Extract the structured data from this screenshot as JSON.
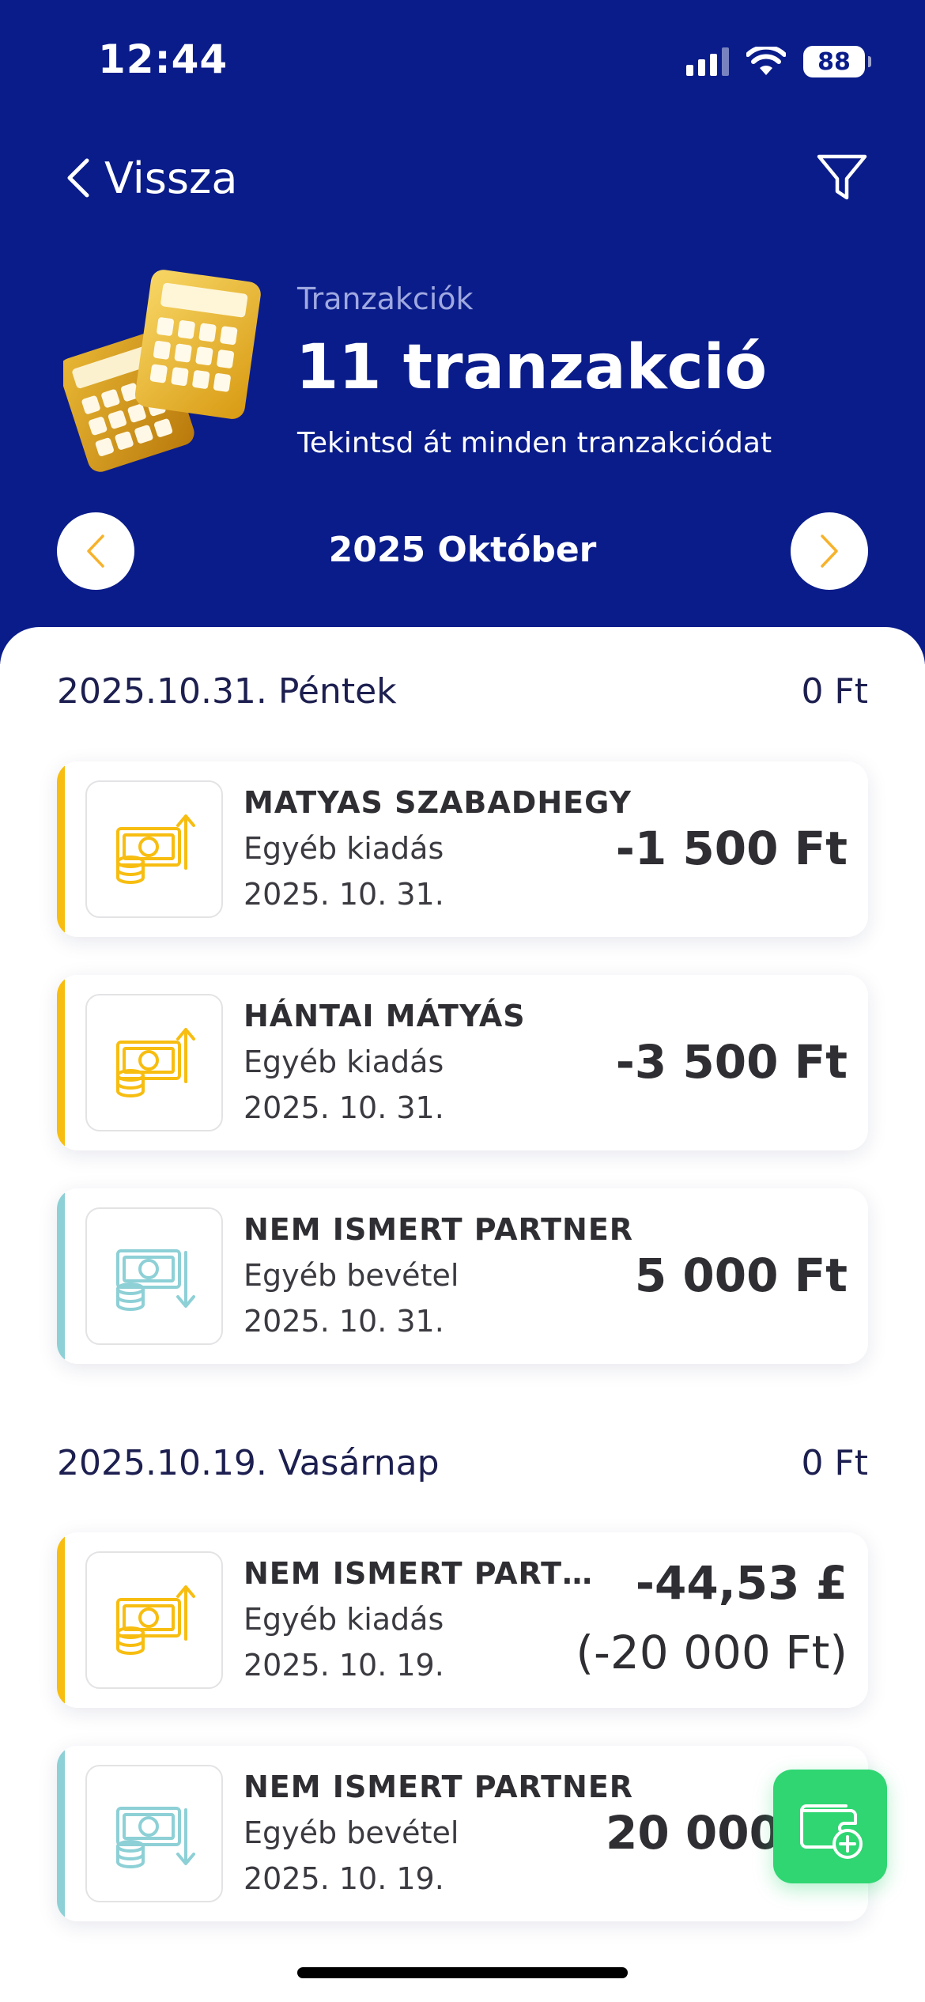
{
  "status_bar": {
    "time": "12:44",
    "battery": "88"
  },
  "nav": {
    "back_label": "Vissza"
  },
  "hero": {
    "eyebrow": "Tranzakciók",
    "title": "11 tranzakció",
    "subtitle": "Tekintsd át minden tranzakciódat"
  },
  "month": {
    "label": "2025 Október"
  },
  "days": [
    {
      "date": "2025.10.31. Péntek",
      "total": "0 Ft",
      "transactions": [
        {
          "partner": "MATYAS SZABADHEGY",
          "category": "Egyéb kiadás",
          "date": "2025. 10. 31.",
          "amount": "-1 500 Ft",
          "type": "expense"
        },
        {
          "partner": "HÁNTAI MÁTYÁS",
          "category": "Egyéb kiadás",
          "date": "2025. 10. 31.",
          "amount": "-3 500 Ft",
          "type": "expense"
        },
        {
          "partner": "NEM ISMERT PARTNER",
          "category": "Egyéb bevétel",
          "date": "2025. 10. 31.",
          "amount": "5 000 Ft",
          "type": "income"
        }
      ]
    },
    {
      "date": "2025.10.19. Vasárnap",
      "total": "0 Ft",
      "transactions": [
        {
          "partner": "NEM ISMERT PART…",
          "category": "Egyéb kiadás",
          "date": "2025. 10. 19.",
          "amount": "-44,53 £",
          "amount_sub": "(-20 000 Ft)",
          "type": "expense"
        },
        {
          "partner": "NEM ISMERT PARTNER",
          "category": "Egyéb bevétel",
          "date": "2025. 10. 19.",
          "amount": "20 000",
          "type": "income"
        }
      ]
    }
  ],
  "colors": {
    "header_bg": "#0a1c8a",
    "expense_accent": "#f7bd10",
    "income_accent": "#8dd0d6",
    "fab": "#2fd672",
    "arrow": "#f7b22b"
  },
  "icons": {
    "back": "chevron-left-icon",
    "filter": "filter-icon",
    "hero": "calculator-icon",
    "expense": "money-expense-icon",
    "income": "money-income-icon",
    "fab": "add-wallet-icon"
  }
}
